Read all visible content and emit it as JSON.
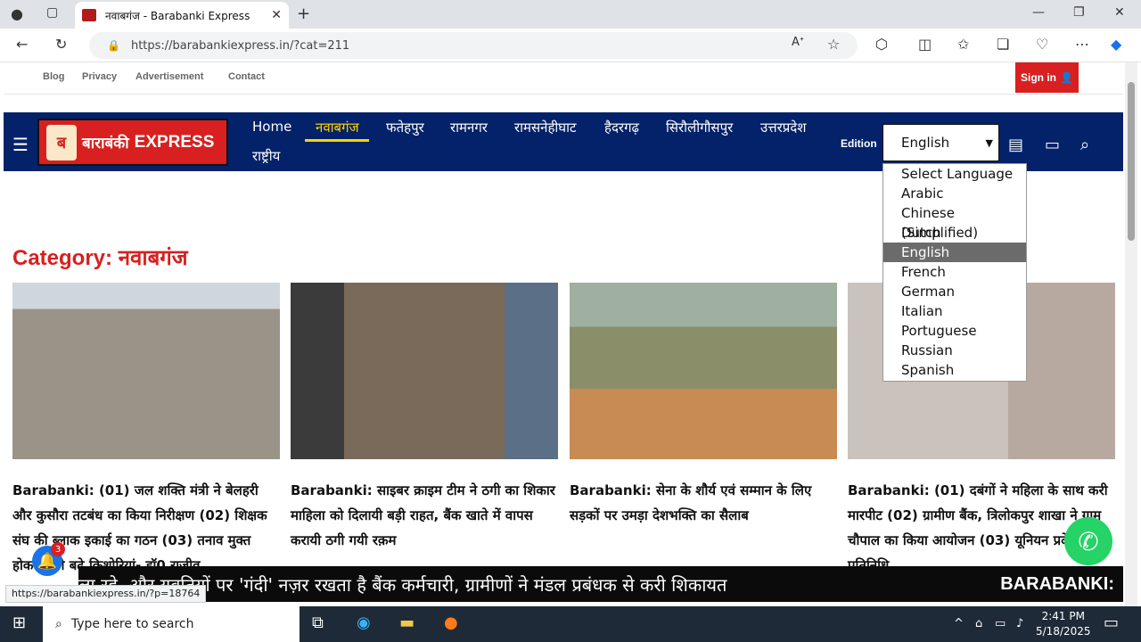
{
  "browser": {
    "tab_title": "नवाबगंज - Barabanki Express",
    "url": "https://barabankiexpress.in/?cat=211",
    "status_url": "https://barabankiexpress.in/?p=18764"
  },
  "topnav": {
    "links": [
      "Blog",
      "Privacy",
      "Advertisement",
      "Contact"
    ],
    "sign_in": "Sign in"
  },
  "logo": {
    "hindi": "बाराबंकी",
    "english": "EXPRESS"
  },
  "menu": {
    "items": [
      "Home",
      "नवाबगंज",
      "फतेहपुर",
      "रामनगर",
      "रामसनेहीघाट",
      "हैदरगढ़",
      "सिरौलीगौसपुर",
      "उत्तरप्रदेश",
      "राष्ट्रीय"
    ],
    "active": "नवाबगंज"
  },
  "edition": {
    "label": "Edition",
    "selected": "English",
    "options": [
      "Select Language",
      "Arabic",
      "Chinese (Simplified)",
      "Dutch",
      "English",
      "French",
      "German",
      "Italian",
      "Portuguese",
      "Russian",
      "Spanish"
    ]
  },
  "category": {
    "title": "Category: नवाबगंज"
  },
  "articles": [
    {
      "title": "Barabanki: (01) जल शक्ति मंत्री ने बेलहरी और कुसौरा तटबंध का किया निरीक्षण (02) शिक्षक संघ की ब्लाक इकाई का गठन (03) तनाव मुक्त होकर आगे बढ़े किशोरियां- डॉ0 राजीव",
      "image_color": "#9a9488"
    },
    {
      "title": "Barabanki: साइबर क्राइम टीम ने ठगी का शिकार माहिला को दिलायी बड़ी राहत, बैंक खाते में वापस करायी ठगी गयी रक़म",
      "image_color": "#7a6a5a"
    },
    {
      "title": "Barabanki: सेना के शौर्य एवं सम्मान के लिए सड़कों पर उमड़ा देशभक्ति का सैलाब",
      "image_color": "#8a8f6a"
    },
    {
      "title": "Barabanki: (01) दबंगों ने महिला के साथ करी मारपीट (02) ग्रामीण बैंक, त्रिलोकपुर शाखा ने ग्राम चौपाल का किया आयोजन (03) यूनियन प्रदेश प्रतिनिधि",
      "image_color": "#b8a9a0"
    }
  ],
  "ticker": {
    "text": "ला रहे, और युवतियों पर 'गंदी' नज़र रखता है बैंक कर्मचारी, ग्रामीणों ने मंडल प्रबंधक से करी शिकायत",
    "brand": "BARABANKI:"
  },
  "notification_count": "3",
  "taskbar": {
    "search_placeholder": "Here to search",
    "search_label": "Type here to search",
    "time": "2:41 PM",
    "date": "5/18/2025"
  },
  "colors": {
    "brand_red": "#d7201f",
    "nav_blue": "#03226a",
    "active_yellow": "#ffd400"
  }
}
